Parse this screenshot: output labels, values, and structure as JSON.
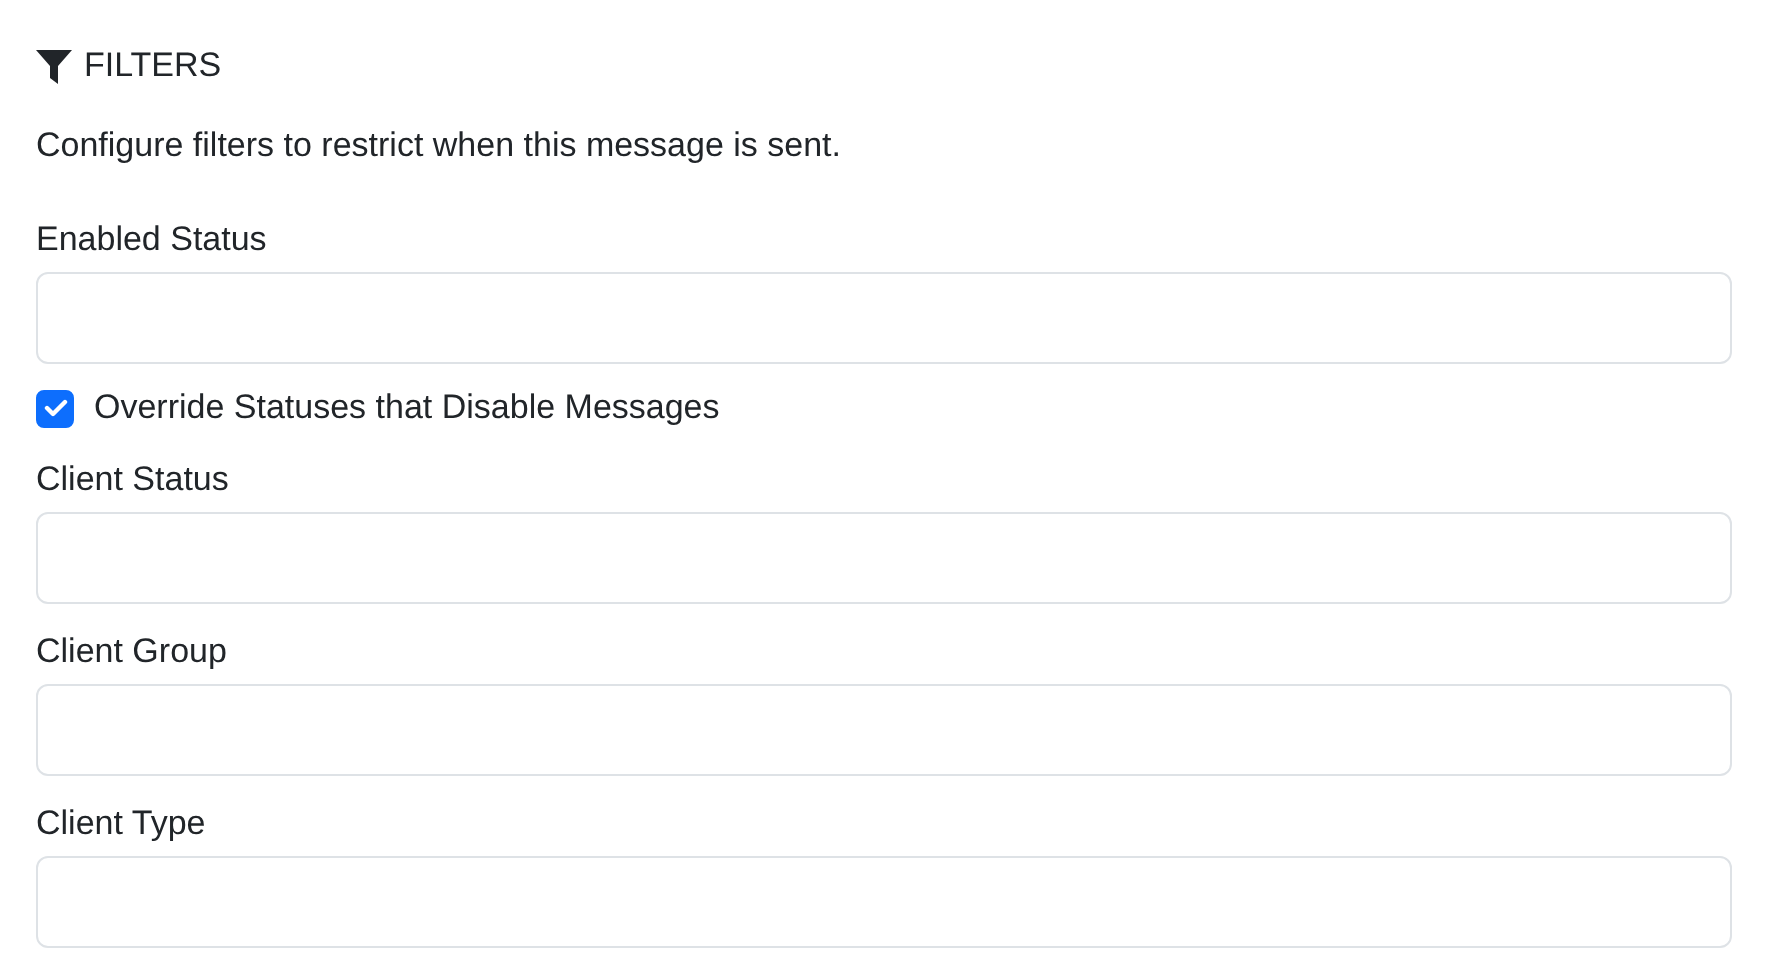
{
  "section": {
    "title": "FILTERS",
    "description": "Configure filters to restrict when this message is sent."
  },
  "items": [
    {
      "kind": "field",
      "label": "Enabled Status"
    },
    {
      "kind": "checkbox",
      "label": "Override Statuses that Disable Messages",
      "checked": true
    },
    {
      "kind": "field",
      "label": "Client Status"
    },
    {
      "kind": "field",
      "label": "Client Group"
    },
    {
      "kind": "field",
      "label": "Client Type"
    }
  ]
}
